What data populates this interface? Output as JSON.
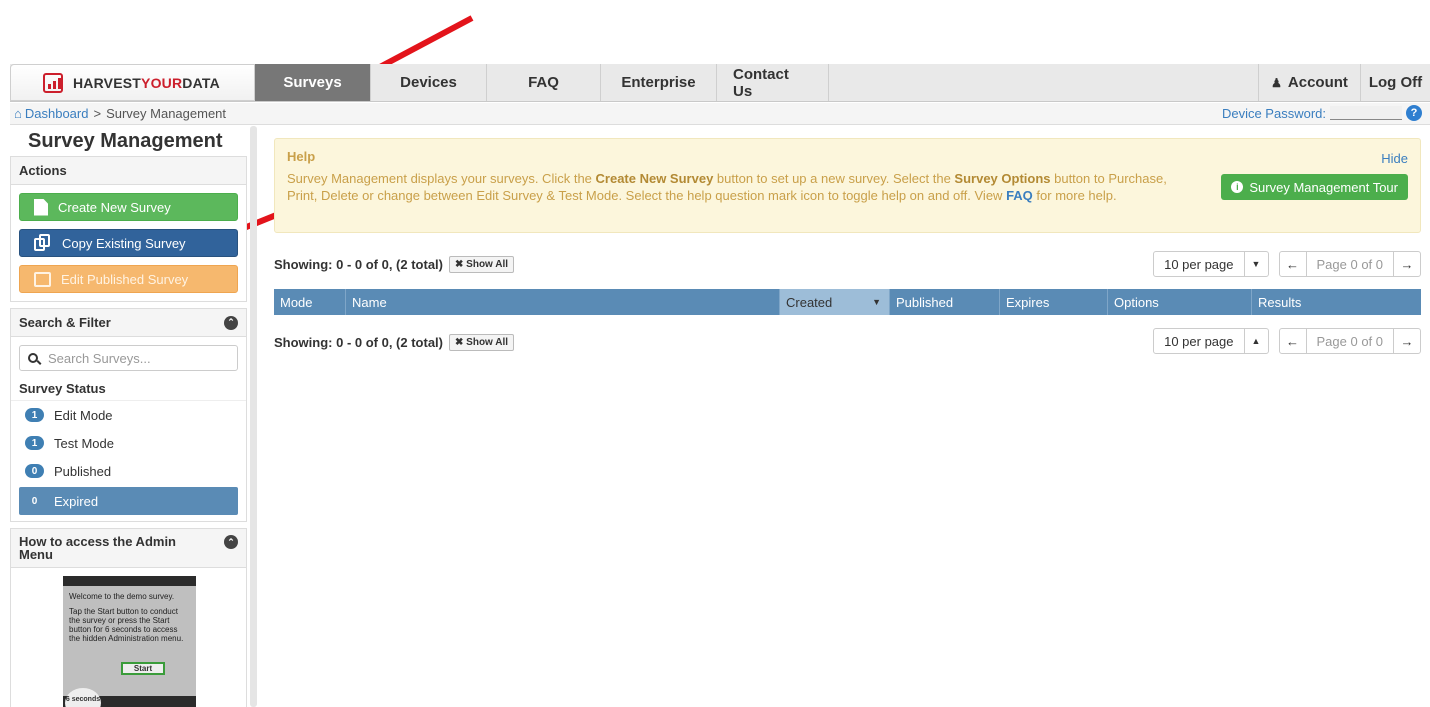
{
  "brand": {
    "harvest": "HARVEST",
    "your": "YOUR",
    "data": "DATA",
    "accent": "#cc1f2c"
  },
  "nav": {
    "tabs": [
      "Surveys",
      "Devices",
      "FAQ",
      "Enterprise",
      "Contact Us"
    ],
    "account": "Account",
    "logoff": "Log Off"
  },
  "breadcrumb": {
    "home": "Dashboard",
    "sep": ">",
    "current": "Survey Management"
  },
  "device_password_label": "Device Password:",
  "sidebar": {
    "title": "Survey Management",
    "actions_title": "Actions",
    "actions": [
      "Create New Survey",
      "Copy Existing Survey",
      "Edit Published Survey"
    ],
    "search_title": "Search & Filter",
    "search_placeholder": "Search Surveys...",
    "status_title": "Survey Status",
    "statuses": [
      {
        "count": "1",
        "label": "Edit Mode"
      },
      {
        "count": "1",
        "label": "Test Mode"
      },
      {
        "count": "0",
        "label": "Published"
      },
      {
        "count": "0",
        "label": "Expired"
      }
    ],
    "admin_title": "How to access the Admin Menu",
    "demo": {
      "welcome": "Welcome to the demo survey.",
      "instructions": "Tap the Start button to conduct the survey or press the Start button for 6 seconds to access the hidden Administration menu.",
      "start": "Start",
      "seconds": "6 seconds"
    }
  },
  "help": {
    "title": "Help",
    "hide": "Hide",
    "text_1": "Survey Management displays your surveys. Click the ",
    "b1": "Create New Survey",
    "text_2": " button to set up a new survey. Select the ",
    "b2": "Survey Options",
    "text_3": " button to Purchase, Print, Delete or change between Edit Survey & Test Mode. Select the help question mark icon to toggle help on and off. View ",
    "faq": "FAQ",
    "text_4": " for more help.",
    "tour": "Survey Management Tour"
  },
  "listing": {
    "showing": "Showing: 0 - 0 of 0, (2 total)",
    "show_all": "Show All",
    "per_page": "10 per page",
    "page": "Page 0 of 0"
  },
  "table": {
    "columns": [
      "Mode",
      "Name",
      "Created",
      "Published",
      "Expires",
      "Options",
      "Results"
    ]
  }
}
